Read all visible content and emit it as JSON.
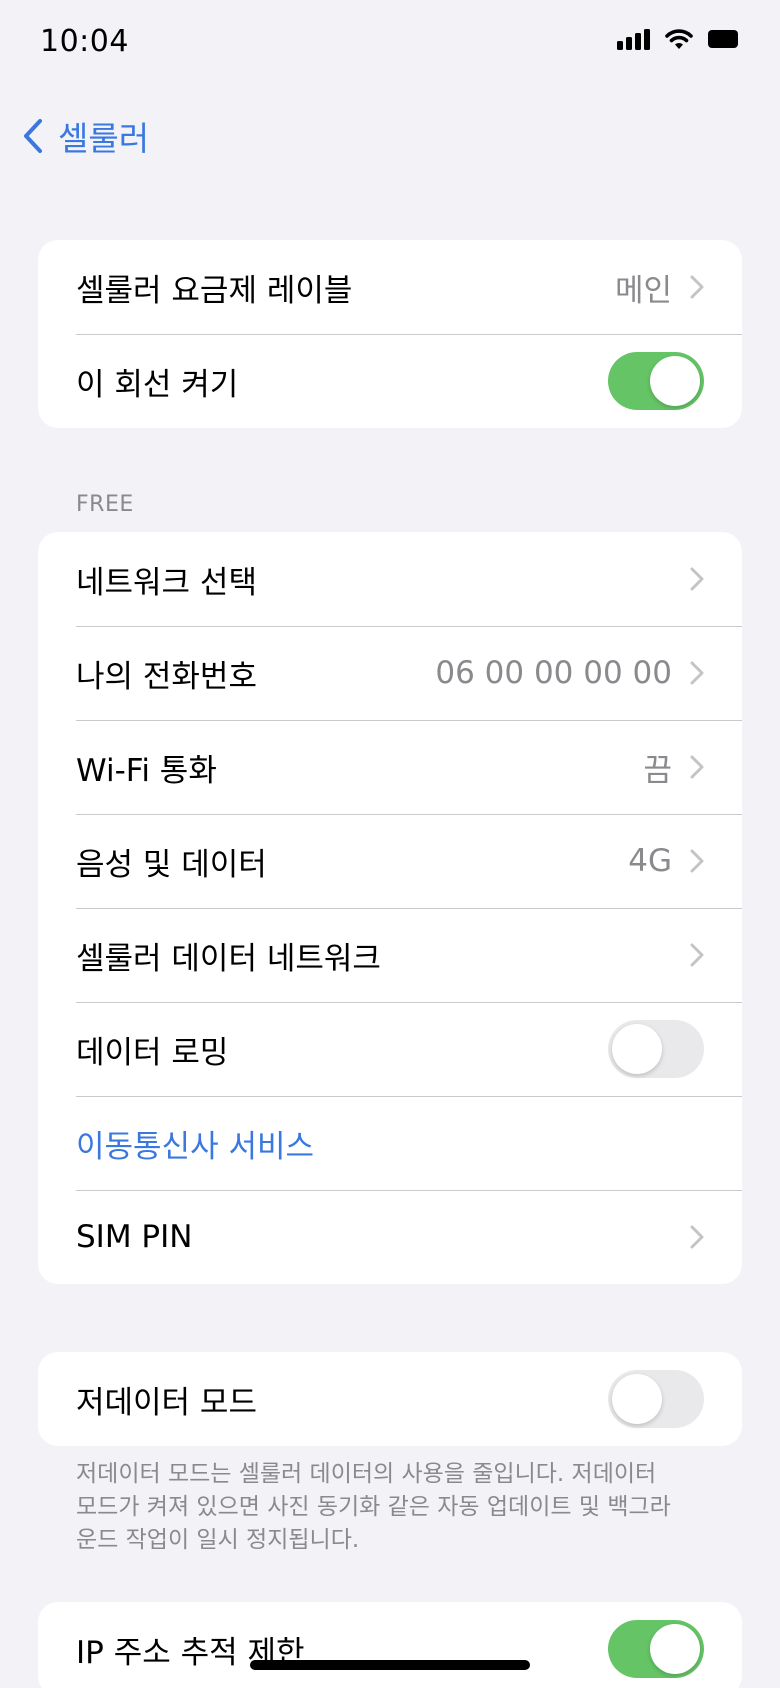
{
  "status_bar": {
    "time": "10:04"
  },
  "nav": {
    "back_label": "셀룰러"
  },
  "group1": {
    "plan_label": {
      "label": "셀룰러 요금제 레이블",
      "value": "메인"
    },
    "line_toggle": {
      "label": "이 회선 켜기",
      "state": "on"
    }
  },
  "section_header": "FREE",
  "group2": {
    "network_select": {
      "label": "네트워크 선택"
    },
    "my_number": {
      "label": "나의 전화번호",
      "value": "06 00 00 00 00"
    },
    "wifi_calling": {
      "label": "Wi-Fi 통화",
      "value": "끔"
    },
    "voice_data": {
      "label": "음성 및 데이터",
      "value": "4G"
    },
    "cellular_data_network": {
      "label": "셀룰러 데이터 네트워크"
    },
    "data_roaming": {
      "label": "데이터 로밍",
      "state": "off"
    },
    "carrier_services": {
      "label": "이동통신사 서비스"
    },
    "sim_pin": {
      "label": "SIM PIN"
    }
  },
  "group3": {
    "low_data_mode": {
      "label": "저데이터 모드",
      "state": "off"
    }
  },
  "low_data_footer": "저데이터 모드는 셀룰러 데이터의 사용을 줄입니다. 저데이터 모드가 켜져 있으면 사진 동기화 같은 자동 업데이트 및 백그라운드 작업이 일시 정지됩니다.",
  "group4": {
    "limit_ip_tracking": {
      "label": "IP 주소 추적 제한",
      "state": "on"
    }
  },
  "colors": {
    "accent": "#3a78e0",
    "toggle_on": "#65c466",
    "background": "#f2f2f7"
  }
}
